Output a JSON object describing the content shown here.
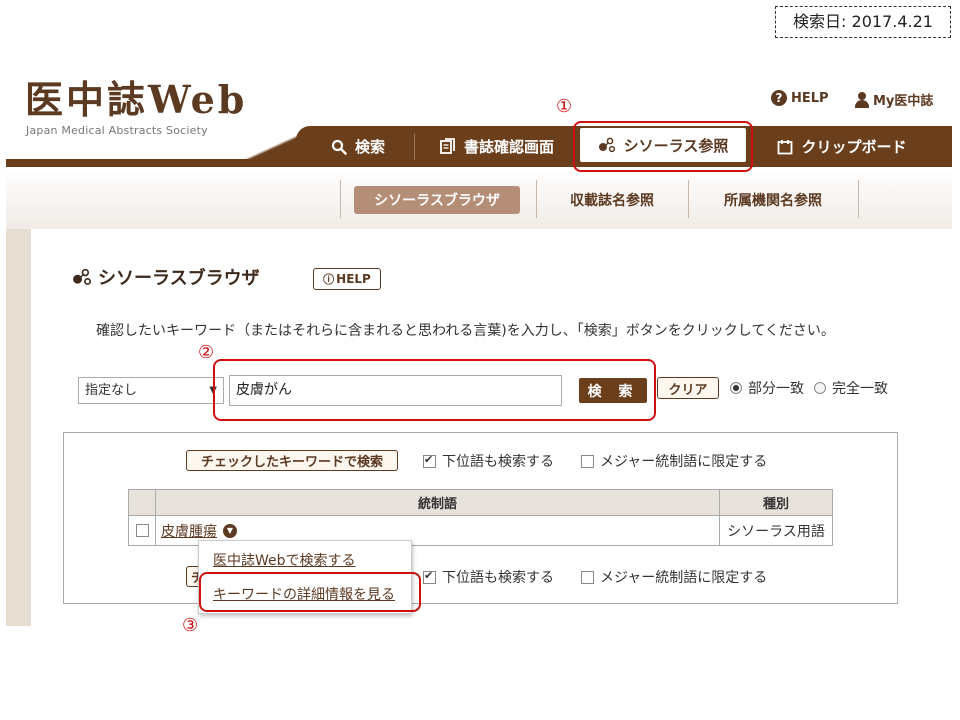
{
  "search_date": "検索日: 2017.4.21",
  "logo": {
    "title": "医中誌Web",
    "subtitle": "Japan Medical Abstracts Society"
  },
  "top_links": {
    "help": "HELP",
    "my": "My医中誌"
  },
  "nav": {
    "search": "検索",
    "bib_confirm": "書誌確認画面",
    "thesaurus": "シソーラス参照",
    "clipboard": "クリップボード"
  },
  "subnav": {
    "browser": "シソーラスブラウザ",
    "journal": "収載誌名参照",
    "affiliation": "所属機関名参照"
  },
  "page": {
    "title": "シソーラスブラウザ",
    "help_button": "HELP",
    "instruction": "確認したいキーワード（またはそれらに含まれると思われる言葉)を入力し、「検索」ボタンをクリックしてください。"
  },
  "search": {
    "select_value": "指定なし",
    "input_value": "皮膚がん",
    "search_button": "検 索",
    "clear_button": "クリア",
    "radio_partial": "部分一致",
    "radio_exact": "完全一致"
  },
  "results": {
    "check_search_button": "チェックしたキーワードで検索",
    "include_lower": "下位語も検索する",
    "major_only": "メジャー統制語に限定する",
    "columns": {
      "term": "統制語",
      "type": "種別"
    },
    "rows": [
      {
        "term": "皮膚腫瘍",
        "type": "シソーラス用語"
      }
    ],
    "bottom_button_partial": "チ"
  },
  "popup": {
    "item1": "医中誌Webで検索する",
    "item2": "キーワードの詳細情報を見る"
  },
  "annotations": {
    "a1": "①",
    "a2": "②",
    "a3": "③"
  },
  "colors": {
    "brand_brown": "#6b3f1c",
    "annotation_red": "#d01010",
    "subnav_active": "#b58e78"
  }
}
